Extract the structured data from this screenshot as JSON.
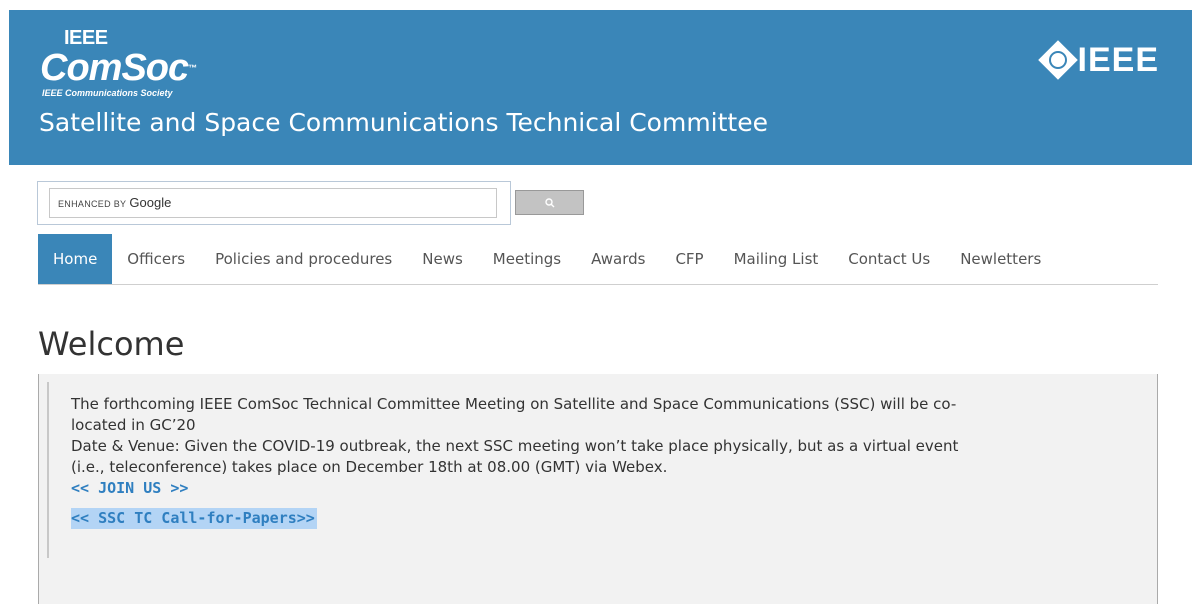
{
  "header": {
    "logo_ieee": "IEEE",
    "logo_comsoc": "ComSoc",
    "logo_tm": "™",
    "logo_subtitle": "IEEE Communications Society",
    "ieee_brand": "IEEE",
    "site_title": "Satellite and Space Communications Technical Committee",
    "background_color": "#3a86b8"
  },
  "search": {
    "brand_prefix": "ENHANCED BY",
    "brand_name": "Google",
    "button_icon": "search-icon"
  },
  "nav": {
    "items": [
      {
        "label": "Home",
        "active": true
      },
      {
        "label": "Officers"
      },
      {
        "label": "Policies and procedures"
      },
      {
        "label": "News"
      },
      {
        "label": "Meetings"
      },
      {
        "label": "Awards"
      },
      {
        "label": "CFP"
      },
      {
        "label": "Mailing List"
      },
      {
        "label": "Contact Us"
      },
      {
        "label": "Newletters"
      }
    ],
    "active_color": "#3a86b8"
  },
  "main": {
    "heading": "Welcome",
    "line1": "The forthcoming IEEE ComSoc Technical Committee Meeting on Satellite and Space Communications (SSC) will be co-",
    "line2": "located in GC’20",
    "line3": "Date & Venue: Given the COVID-19 outbreak, the next SSC meeting won’t take place physically, but as a virtual event",
    "line4": "(i.e., teleconference) takes place on December 18th at 08.00 (GMT) via Webex.",
    "join_link": "<< JOIN US >>",
    "cfp_link": "<< SSC TC Call-for-Papers>>",
    "link_color": "#2f7fc0"
  }
}
